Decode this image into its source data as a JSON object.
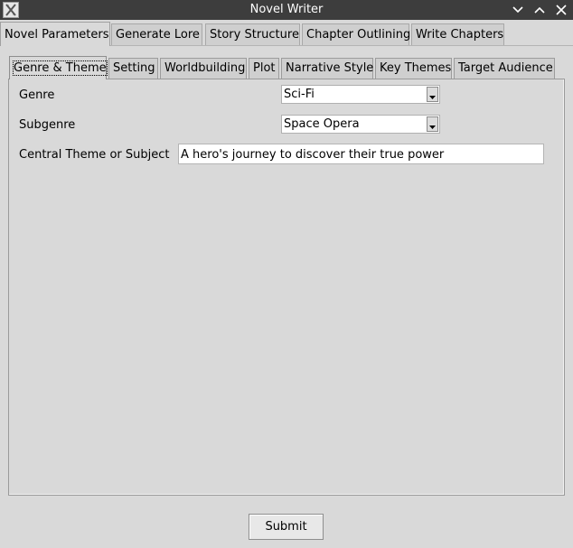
{
  "window": {
    "title": "Novel Writer"
  },
  "outer_tabs": [
    {
      "label": "Novel Parameters",
      "active": true
    },
    {
      "label": "Generate Lore",
      "active": false
    },
    {
      "label": "Story Structure",
      "active": false
    },
    {
      "label": "Chapter Outlining",
      "active": false
    },
    {
      "label": "Write Chapters",
      "active": false
    }
  ],
  "inner_tabs": [
    {
      "label": "Genre & Theme",
      "active": true
    },
    {
      "label": "Setting",
      "active": false
    },
    {
      "label": "Worldbuilding",
      "active": false
    },
    {
      "label": "Plot",
      "active": false
    },
    {
      "label": "Narrative Style",
      "active": false
    },
    {
      "label": "Key Themes",
      "active": false
    },
    {
      "label": "Target Audience",
      "active": false
    }
  ],
  "form": {
    "genre": {
      "label": "Genre",
      "value": "Sci-Fi"
    },
    "subgenre": {
      "label": "Subgenre",
      "value": "Space Opera"
    },
    "central_theme": {
      "label": "Central Theme or Subject",
      "value": "A hero's journey to discover their true power"
    }
  },
  "actions": {
    "submit_label": "Submit"
  },
  "icons": {
    "app": "app-x-icon",
    "minimize": "chevron-down-icon",
    "maximize": "chevron-up-icon",
    "close": "close-icon",
    "dropdown": "dropdown-arrow-icon"
  },
  "colors": {
    "titlebar": "#3d3d3d",
    "background": "#d9d9d9",
    "inactive_tab": "#cfcfcf",
    "input_bg": "#ffffff"
  }
}
